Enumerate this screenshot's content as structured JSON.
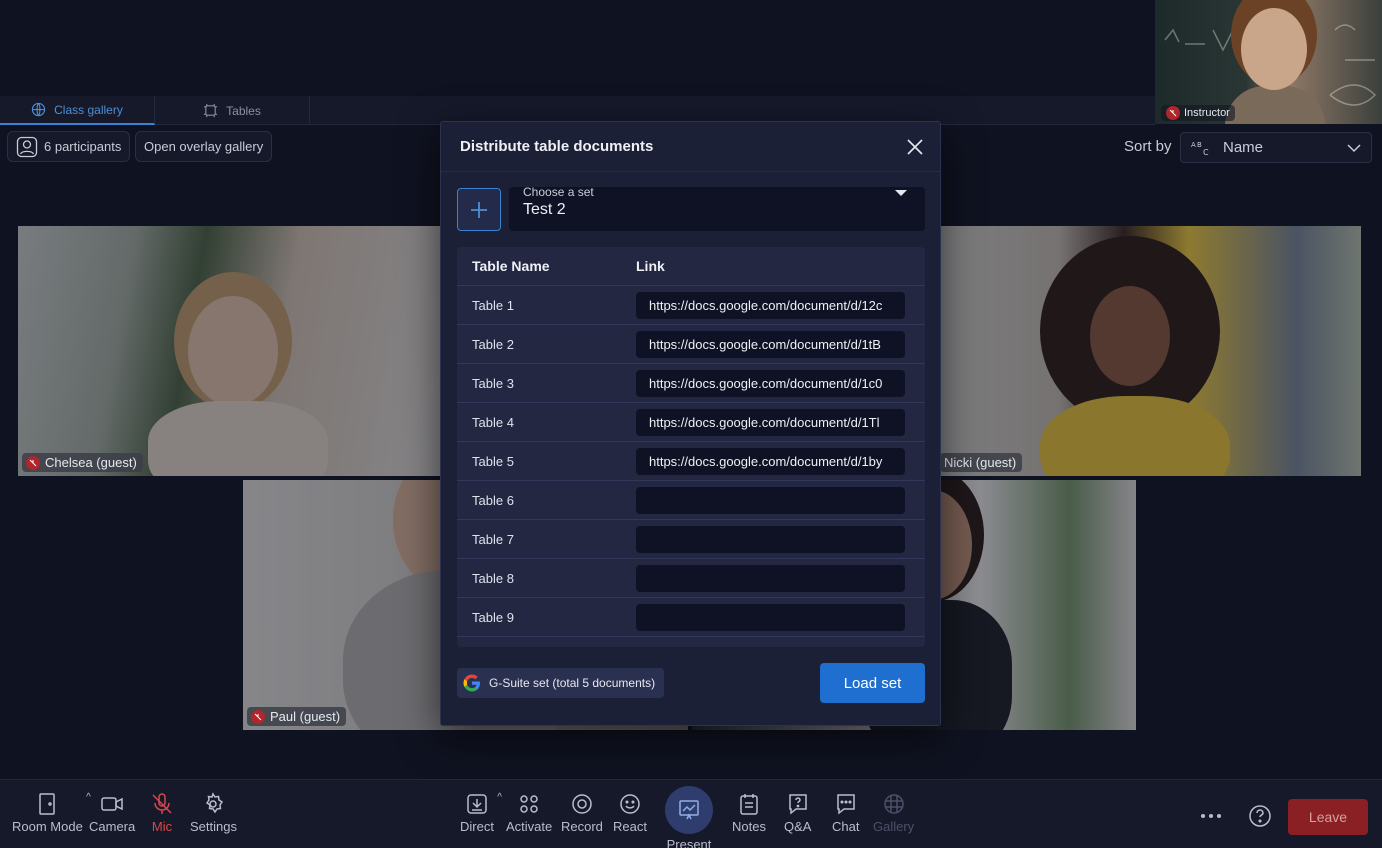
{
  "top_tabs": [
    {
      "label": "Class gallery",
      "icon": "globe-icon",
      "active": true
    },
    {
      "label": "Tables",
      "icon": "tables-icon",
      "active": false
    }
  ],
  "instructor": {
    "label": "Instructor"
  },
  "participants": {
    "label": "6 participants"
  },
  "overlay": {
    "label": "Open overlay gallery"
  },
  "sort": {
    "label": "Sort by",
    "value": "Name"
  },
  "tiles": {
    "chelsea": "Chelsea (guest)",
    "nicki": "Nicki (guest)",
    "paul": "Paul (guest)"
  },
  "modal": {
    "title": "Distribute table documents",
    "set_caption": "Choose a set",
    "set_value": "Test 2",
    "col_table": "Table Name",
    "col_link": "Link",
    "rows": [
      {
        "name": "Table 1",
        "link": "https://docs.google.com/document/d/12c"
      },
      {
        "name": "Table 2",
        "link": "https://docs.google.com/document/d/1tB"
      },
      {
        "name": "Table 3",
        "link": "https://docs.google.com/document/d/1c0"
      },
      {
        "name": "Table 4",
        "link": "https://docs.google.com/document/d/1Tl"
      },
      {
        "name": "Table 5",
        "link": "https://docs.google.com/document/d/1by"
      },
      {
        "name": "Table 6",
        "link": ""
      },
      {
        "name": "Table 7",
        "link": ""
      },
      {
        "name": "Table 8",
        "link": ""
      },
      {
        "name": "Table 9",
        "link": ""
      }
    ],
    "gsuite_label": "G-Suite set (total 5 documents)",
    "load_label": "Load set"
  },
  "bottombar": {
    "room_mode": "Room Mode",
    "camera": "Camera",
    "mic": "Mic",
    "settings": "Settings",
    "direct": "Direct",
    "activate": "Activate",
    "record": "Record",
    "react": "React",
    "present": "Present",
    "notes": "Notes",
    "qa": "Q&A",
    "chat": "Chat",
    "gallery": "Gallery",
    "leave": "Leave"
  },
  "colors": {
    "accent": "#1f6fd1",
    "mic_off": "#b0262b",
    "leave": "#8a1f24"
  }
}
